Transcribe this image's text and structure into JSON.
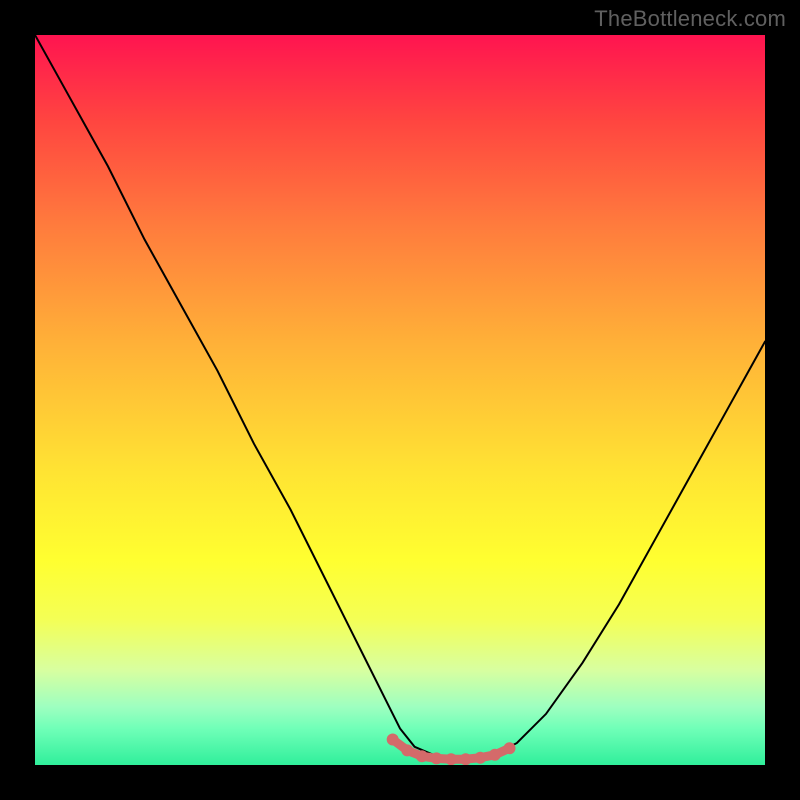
{
  "watermark": "TheBottleneck.com",
  "colors": {
    "dot": "#d46a6a",
    "curve": "#000000",
    "frame": "#000000"
  },
  "chart_data": {
    "type": "line",
    "title": "",
    "xlabel": "",
    "ylabel": "",
    "xlim": [
      0,
      100
    ],
    "ylim": [
      0,
      100
    ],
    "axes_visible": false,
    "grid": false,
    "series": [
      {
        "name": "bottleneck-curve",
        "x": [
          0,
          5,
          10,
          15,
          20,
          25,
          30,
          35,
          40,
          45,
          48,
          50,
          52,
          55,
          57,
          59,
          61,
          63,
          66,
          70,
          75,
          80,
          85,
          90,
          95,
          100
        ],
        "y": [
          100,
          91,
          82,
          72,
          63,
          54,
          44,
          35,
          25,
          15,
          9,
          5,
          2.5,
          1.2,
          0.8,
          0.8,
          1.0,
          1.5,
          3,
          7,
          14,
          22,
          31,
          40,
          49,
          58
        ]
      }
    ],
    "optimal_zone": {
      "name": "flat-minimum-dots",
      "x": [
        49,
        51,
        53,
        55,
        57,
        59,
        61,
        63,
        65
      ],
      "y": [
        3.5,
        2.0,
        1.2,
        0.9,
        0.8,
        0.8,
        1.0,
        1.4,
        2.3
      ]
    },
    "gradient_stops": [
      {
        "pos": 0.0,
        "color": "#ff1450"
      },
      {
        "pos": 0.12,
        "color": "#ff4640"
      },
      {
        "pos": 0.26,
        "color": "#ff7b3d"
      },
      {
        "pos": 0.42,
        "color": "#ffb038"
      },
      {
        "pos": 0.6,
        "color": "#ffe433"
      },
      {
        "pos": 0.72,
        "color": "#ffff30"
      },
      {
        "pos": 0.8,
        "color": "#f4ff55"
      },
      {
        "pos": 0.87,
        "color": "#d8ffa0"
      },
      {
        "pos": 0.92,
        "color": "#9effc0"
      },
      {
        "pos": 0.95,
        "color": "#70ffb8"
      },
      {
        "pos": 1.0,
        "color": "#30ef9b"
      }
    ]
  }
}
